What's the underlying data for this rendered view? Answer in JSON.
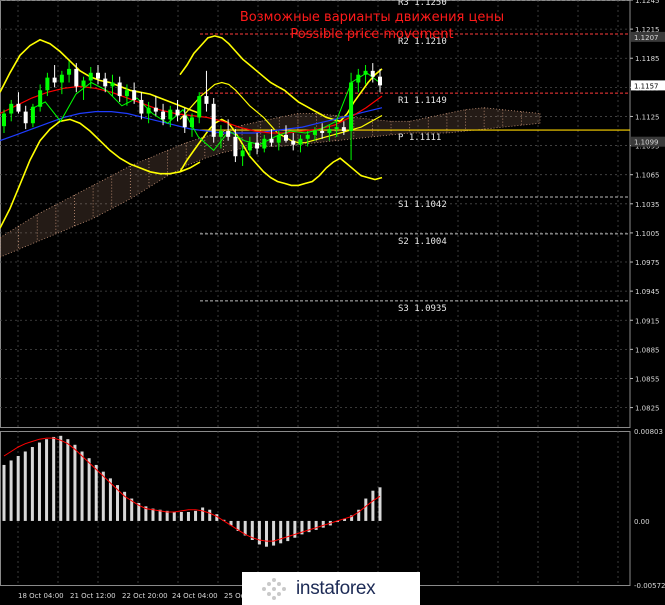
{
  "chart_data": {
    "type": "candlestick",
    "title": "Возможные варианты движения цены",
    "subtitle": "Possible price movement",
    "price_axis": {
      "ylim": [
        1.0805,
        1.1245
      ],
      "ticks": [
        "1.1245",
        "1.1215",
        "1.1185",
        "1.1155",
        "1.1125",
        "1.1095",
        "1.1065",
        "1.1035",
        "1.1005",
        "1.0975",
        "1.0945",
        "1.0915",
        "1.0885",
        "1.0855",
        "1.0825"
      ],
      "tick_values": [
        1.1245,
        1.1215,
        1.1185,
        1.1155,
        1.1125,
        1.1095,
        1.1065,
        1.1035,
        1.1005,
        1.0975,
        1.0945,
        1.0915,
        1.0885,
        1.0855,
        1.0825
      ],
      "current_price_label": "1.1157",
      "current_price": 1.1157,
      "marker_labels": [
        {
          "text": "1.1207",
          "value": 1.1207
        },
        {
          "text": "1.1099",
          "value": 1.1099
        }
      ]
    },
    "pivot_levels": [
      {
        "label": "R3 1.1250",
        "value": 1.125
      },
      {
        "label": "R2 1.1210",
        "value": 1.121
      },
      {
        "label": "R1 1.1149",
        "value": 1.1149
      },
      {
        "label": "P 1.1111",
        "value": 1.1111
      },
      {
        "label": "S1 1.1042",
        "value": 1.1042
      },
      {
        "label": "S2 1.1004",
        "value": 1.1004
      },
      {
        "label": "S3 1.0935",
        "value": 1.0935
      }
    ],
    "x_axis": {
      "labels": [
        "18 Oct 04:00",
        "21 Oct 12:00",
        "22 Oct 20:00",
        "24 Oct 04:00",
        "25 Oc"
      ]
    },
    "candles": [
      [
        1.1115,
        1.1132,
        1.1108,
        1.1128
      ],
      [
        1.1128,
        1.1142,
        1.112,
        1.1138
      ],
      [
        1.1138,
        1.115,
        1.1128,
        1.113
      ],
      [
        1.113,
        1.1136,
        1.1112,
        1.1118
      ],
      [
        1.1118,
        1.1138,
        1.1114,
        1.1135
      ],
      [
        1.1135,
        1.1158,
        1.113,
        1.1152
      ],
      [
        1.1152,
        1.117,
        1.1146,
        1.1165
      ],
      [
        1.1165,
        1.1178,
        1.1155,
        1.116
      ],
      [
        1.116,
        1.1172,
        1.1148,
        1.1168
      ],
      [
        1.1168,
        1.1182,
        1.116,
        1.1174
      ],
      [
        1.1174,
        1.118,
        1.115,
        1.1156
      ],
      [
        1.1156,
        1.1166,
        1.1142,
        1.1162
      ],
      [
        1.1162,
        1.1176,
        1.1154,
        1.117
      ],
      [
        1.117,
        1.1178,
        1.1158,
        1.1164
      ],
      [
        1.1164,
        1.117,
        1.115,
        1.1156
      ],
      [
        1.1156,
        1.1168,
        1.1146,
        1.116
      ],
      [
        1.116,
        1.1166,
        1.114,
        1.1146
      ],
      [
        1.1146,
        1.1158,
        1.1136,
        1.1152
      ],
      [
        1.1152,
        1.116,
        1.1138,
        1.1142
      ],
      [
        1.1142,
        1.115,
        1.1122,
        1.1128
      ],
      [
        1.1128,
        1.114,
        1.1118,
        1.1134
      ],
      [
        1.1134,
        1.1146,
        1.1126,
        1.113
      ],
      [
        1.113,
        1.1138,
        1.1116,
        1.1122
      ],
      [
        1.1122,
        1.1136,
        1.1114,
        1.1132
      ],
      [
        1.1132,
        1.1142,
        1.112,
        1.1126
      ],
      [
        1.1126,
        1.1134,
        1.1108,
        1.1114
      ],
      [
        1.1114,
        1.1128,
        1.1104,
        1.1124
      ],
      [
        1.1124,
        1.115,
        1.1118,
        1.1146
      ],
      [
        1.1146,
        1.1172,
        1.113,
        1.1138
      ],
      [
        1.1138,
        1.1144,
        1.1098,
        1.1104
      ],
      [
        1.1104,
        1.1116,
        1.1092,
        1.111
      ],
      [
        1.111,
        1.1122,
        1.11,
        1.1104
      ],
      [
        1.1104,
        1.1112,
        1.1078,
        1.1084
      ],
      [
        1.1084,
        1.1096,
        1.1074,
        1.109
      ],
      [
        1.109,
        1.1104,
        1.1084,
        1.1098
      ],
      [
        1.1098,
        1.1108,
        1.1086,
        1.1092
      ],
      [
        1.1092,
        1.1106,
        1.1088,
        1.1102
      ],
      [
        1.1102,
        1.1112,
        1.1094,
        1.1098
      ],
      [
        1.1098,
        1.111,
        1.109,
        1.1106
      ],
      [
        1.1106,
        1.1116,
        1.1098,
        1.11
      ],
      [
        1.11,
        1.1108,
        1.109,
        1.1096
      ],
      [
        1.1096,
        1.1106,
        1.1088,
        1.1102
      ],
      [
        1.1102,
        1.111,
        1.1094,
        1.1106
      ],
      [
        1.1106,
        1.1114,
        1.11,
        1.111
      ],
      [
        1.111,
        1.1118,
        1.1102,
        1.1108
      ],
      [
        1.1108,
        1.1116,
        1.11,
        1.1112
      ],
      [
        1.1112,
        1.1122,
        1.1104,
        1.1114
      ],
      [
        1.1114,
        1.112,
        1.1106,
        1.111
      ],
      [
        1.111,
        1.117,
        1.108,
        1.116
      ],
      [
        1.116,
        1.1174,
        1.115,
        1.1168
      ],
      [
        1.1168,
        1.1178,
        1.1158,
        1.1172
      ],
      [
        1.1172,
        1.118,
        1.116,
        1.1166
      ],
      [
        1.1166,
        1.1174,
        1.115,
        1.1157
      ]
    ],
    "bollinger": {
      "upper": [
        1.1168,
        1.1178,
        1.119,
        1.1198,
        1.1206,
        1.1208,
        1.1206,
        1.12,
        1.1192,
        1.1184,
        1.1178,
        1.1172,
        1.1166,
        1.116,
        1.1156,
        1.1152,
        1.1146,
        1.114,
        1.1136,
        1.1132,
        1.1128,
        1.1124,
        1.1122,
        1.112,
        1.1128,
        1.114,
        1.115,
        1.116,
        1.1168,
        1.1174
      ],
      "middle": [
        1.1122,
        1.113,
        1.1138,
        1.1146,
        1.1152,
        1.1158,
        1.116,
        1.1158,
        1.1152,
        1.1144,
        1.1136,
        1.113,
        1.1124,
        1.1116,
        1.1108,
        1.1104,
        1.11,
        1.1098,
        1.1098,
        1.11,
        1.1102,
        1.1104,
        1.1106,
        1.1108,
        1.111,
        1.1112,
        1.1114,
        1.1118,
        1.1122,
        1.1126
      ],
      "lower": [
        1.1068,
        1.108,
        1.109,
        1.11,
        1.111,
        1.1118,
        1.1122,
        1.1118,
        1.1108,
        1.1096,
        1.1084,
        1.1076,
        1.1068,
        1.1062,
        1.1058,
        1.1056,
        1.1054,
        1.1054,
        1.1056,
        1.1058,
        1.1064,
        1.1072,
        1.1078,
        1.1082,
        1.1076,
        1.107,
        1.1064,
        1.1062,
        1.106,
        1.1062
      ]
    },
    "outer_band": {
      "upper": [
        1.115,
        1.117,
        1.1188,
        1.1198,
        1.1204,
        1.12,
        1.1192,
        1.1182,
        1.1172,
        1.1166,
        1.1162,
        1.116,
        1.1156,
        1.1152,
        1.115,
        1.1148,
        1.1144,
        1.114,
        1.1136,
        1.1132,
        1.1128
      ],
      "lower": [
        1.101,
        1.103,
        1.1055,
        1.108,
        1.11,
        1.1112,
        1.112,
        1.1122,
        1.1118,
        1.111,
        1.11,
        1.109,
        1.1082,
        1.1076,
        1.1072,
        1.1068,
        1.1066,
        1.1066,
        1.1068,
        1.1072,
        1.1078
      ]
    },
    "moving_averages": {
      "red": [
        1.1128,
        1.1136,
        1.1144,
        1.115,
        1.1154,
        1.1156,
        1.1154,
        1.115,
        1.1144,
        1.1138,
        1.1132,
        1.1128,
        1.1126,
        1.1124,
        1.112,
        1.1114,
        1.111,
        1.1108,
        1.1108,
        1.111,
        1.1112,
        1.1116,
        1.1124,
        1.1134,
        1.1146
      ],
      "blue": [
        1.11,
        1.1106,
        1.1112,
        1.1118,
        1.1124,
        1.1128,
        1.113,
        1.113,
        1.1128,
        1.1124,
        1.112,
        1.1116,
        1.1112,
        1.111,
        1.1108,
        1.1108,
        1.1108,
        1.111,
        1.1112,
        1.1114,
        1.1118,
        1.1122,
        1.1126,
        1.113,
        1.1134
      ],
      "green": [
        1.1132,
        1.114,
        1.112,
        1.1148,
        1.116,
        1.1152,
        1.1136,
        1.1144,
        1.1128,
        1.1118,
        1.1132,
        1.1104,
        1.109,
        1.111,
        1.11,
        1.1096,
        1.1104,
        1.111,
        1.1108,
        1.1112,
        1.112,
        1.116,
        1.117,
        1.1158
      ]
    },
    "ichimoku_cloud": {
      "top": [
        1.1,
        1.1012,
        1.1024,
        1.1034,
        1.1044,
        1.1054,
        1.1064,
        1.1074,
        1.1082,
        1.109,
        1.1098,
        1.1104,
        1.111,
        1.1116,
        1.112,
        1.1124,
        1.1128,
        1.1128,
        1.1126,
        1.1124,
        1.1122,
        1.112,
        1.112,
        1.1124,
        1.1128,
        1.1132,
        1.1134,
        1.1132,
        1.113,
        1.1128
      ],
      "bottom": [
        1.098,
        1.0988,
        1.0996,
        1.1004,
        1.1012,
        1.102,
        1.103,
        1.104,
        1.1052,
        1.1064,
        1.1074,
        1.1082,
        1.1088,
        1.1092,
        1.1094,
        1.1094,
        1.1096,
        1.1098,
        1.11,
        1.1102,
        1.1104,
        1.1106,
        1.1108,
        1.1108,
        1.1108,
        1.111,
        1.1112,
        1.1114,
        1.1116,
        1.1118
      ]
    },
    "macd": {
      "ylim": [
        -0.00572,
        0.00803
      ],
      "ticks": [
        "0.00803",
        "0.00",
        "-0.00572"
      ],
      "tick_values": [
        0.00803,
        0.0,
        -0.00572
      ],
      "histogram": [
        0.005,
        0.0054,
        0.0058,
        0.0062,
        0.0066,
        0.007,
        0.0073,
        0.0075,
        0.0076,
        0.0073,
        0.0068,
        0.0062,
        0.0056,
        0.005,
        0.0044,
        0.0038,
        0.0032,
        0.0026,
        0.002,
        0.0016,
        0.0013,
        0.0011,
        0.001,
        0.0009,
        0.0008,
        0.0008,
        0.0008,
        0.0009,
        0.0012,
        0.001,
        0.0006,
        0.0001,
        -0.0004,
        -0.0009,
        -0.0013,
        -0.0017,
        -0.0021,
        -0.0023,
        -0.0022,
        -0.002,
        -0.0018,
        -0.0015,
        -0.0012,
        -0.001,
        -0.0008,
        -0.0006,
        -0.0004,
        -0.0001,
        0.0002,
        0.0005,
        0.001,
        0.002,
        0.0027,
        0.003
      ],
      "signal": [
        0.0058,
        0.0062,
        0.0066,
        0.0069,
        0.0071,
        0.0073,
        0.0074,
        0.0074,
        0.0072,
        0.0069,
        0.0064,
        0.0058,
        0.0052,
        0.0046,
        0.004,
        0.0034,
        0.0028,
        0.0022,
        0.0018,
        0.0014,
        0.0011,
        0.001,
        0.0009,
        0.0008,
        0.0008,
        0.0009,
        0.001,
        0.001,
        0.0009,
        0.0007,
        0.0004,
        0.0,
        -0.0004,
        -0.0008,
        -0.0012,
        -0.0015,
        -0.0017,
        -0.0018,
        -0.0018,
        -0.0016,
        -0.0014,
        -0.0012,
        -0.001,
        -0.0008,
        -0.0006,
        -0.0004,
        -0.0002,
        0.0,
        0.0002,
        0.0004,
        0.0008,
        0.0013,
        0.0018,
        0.0022
      ]
    },
    "colors": {
      "candle": "#ffffff",
      "candle_bull": "#00ff00",
      "bollinger": "#ffff00",
      "middle_band": "#ffff00",
      "red_ma": "#ff0000",
      "blue_ma": "#1e3cff",
      "green_ma": "#00ff00",
      "cloud": "#c8967a",
      "pivot_r": "#ff3b3b",
      "pivot_p": "#ffd700",
      "pivot_s": "#bcbcbc",
      "macd_hist": "#d8d8d8",
      "macd_signal": "#ff0000",
      "grid": "#4a4a4a",
      "title": "#ff1a1a"
    },
    "grid": true
  },
  "logo": {
    "text": "instaforex",
    "icon": "instaforex-logo-icon"
  }
}
